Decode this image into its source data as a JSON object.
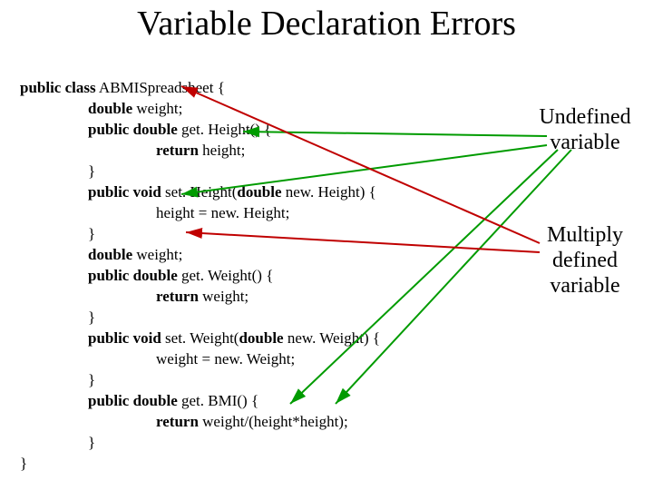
{
  "title": "Variable Declaration Errors",
  "annotations": {
    "undefined": "Undefined variable",
    "multiply": "Multiply defined variable"
  },
  "code": {
    "l01a": "public class",
    "l01b": " ABMISpreadsheet {",
    "l02a": "double",
    "l02b": " weight;",
    "l03a": "public double",
    "l03b": " get. Height() {",
    "l04a": "return",
    "l04b": " height;",
    "l05": "}",
    "l06a": "public void",
    "l06b": " set. Height(",
    "l06c": "double",
    "l06d": " new. Height) {",
    "l07": "height = new. Height;",
    "l08": "}",
    "l09a": "double",
    "l09b": " weight;",
    "l10a": "public double",
    "l10b": " get. Weight() {",
    "l11a": "return",
    "l11b": " weight;",
    "l12": "}",
    "l13a": "public void",
    "l13b": " set. Weight(",
    "l13c": "double",
    "l13d": " new. Weight) {",
    "l14": "weight = new. Weight;",
    "l15": "}",
    "l16a": "public double",
    "l16b": " get. BMI() {",
    "l17a": "return",
    "l17b": " weight/(height*height);",
    "l18": "}",
    "l19": "}"
  },
  "colors": {
    "arrow_undefined": "#009b00",
    "arrow_multiply": "#c00000"
  }
}
